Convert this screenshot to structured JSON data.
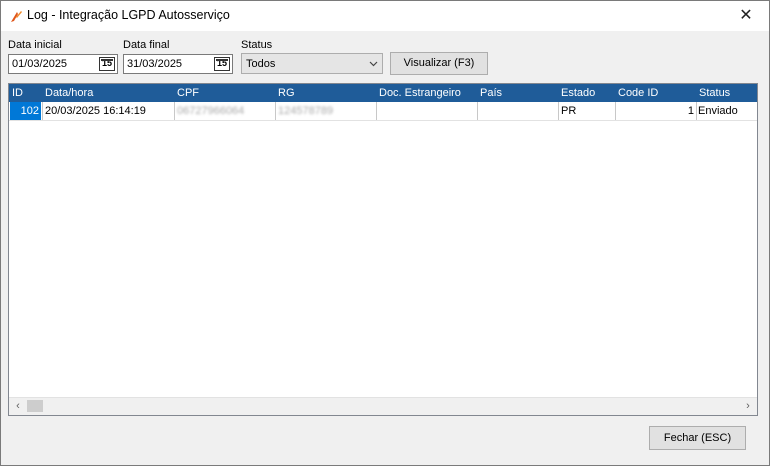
{
  "window": {
    "title": "Log - Integração LGPD Autosserviço",
    "close_glyph": "✕"
  },
  "filters": {
    "data_inicial_label": "Data inicial",
    "data_inicial_value": "01/03/2025",
    "data_final_label": "Data final",
    "data_final_value": "31/03/2025",
    "calendar_glyph": "15",
    "status_label": "Status",
    "status_value": "Todos",
    "visualizar_label": "Visualizar (F3)"
  },
  "grid": {
    "columns": [
      "ID",
      "Data/hora",
      "CPF",
      "RG",
      "Doc. Estrangeiro",
      "País",
      "Estado",
      "Code ID",
      "Status"
    ],
    "rows": [
      {
        "id": "102",
        "data_hora": "20/03/2025 16:14:19",
        "cpf": "06727966064",
        "rg": "124578789",
        "doc_estrangeiro": "",
        "pais": "",
        "estado": "PR",
        "code_id": "1",
        "status": "Enviado"
      }
    ]
  },
  "scroll": {
    "left_glyph": "‹",
    "right_glyph": "›"
  },
  "footer": {
    "fechar_label": "Fechar (ESC)"
  },
  "colors": {
    "header_bg": "#1f5c99",
    "selected_cell": "#0078d7",
    "window_bg": "#f0f0f0"
  }
}
